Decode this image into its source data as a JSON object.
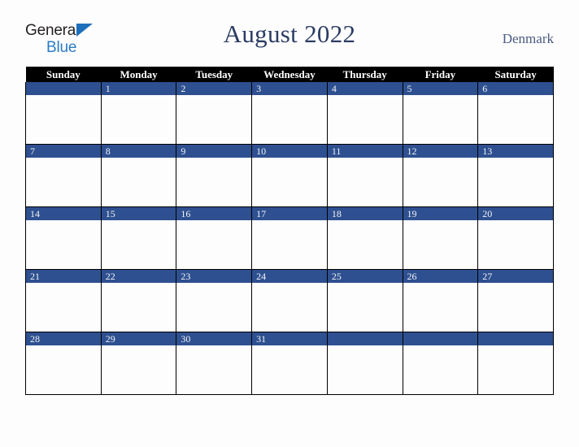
{
  "branding": {
    "logo_text_top": "General",
    "logo_text_bottom": "Blue",
    "logo_triangle_icon": "triangle-icon",
    "logo_top_color": "#231f20",
    "logo_bottom_color": "#2b7cc6",
    "logo_triangle_color": "#1d6fbc"
  },
  "header": {
    "title": "August 2022",
    "region": "Denmark",
    "title_color": "#2b3c63",
    "region_color": "#4a5b82"
  },
  "calendar": {
    "month": "August",
    "year": "2022",
    "header_background": "#000000",
    "header_text_color": "#ffffff",
    "daynum_background": "#2e5090",
    "daynum_text_color": "#f2f4f8",
    "cell_background": "#fdfdfd",
    "border_color": "#000000",
    "weekdays": [
      "Sunday",
      "Monday",
      "Tuesday",
      "Wednesday",
      "Thursday",
      "Friday",
      "Saturday"
    ],
    "weeks": [
      [
        "",
        "1",
        "2",
        "3",
        "4",
        "5",
        "6"
      ],
      [
        "7",
        "8",
        "9",
        "10",
        "11",
        "12",
        "13"
      ],
      [
        "14",
        "15",
        "16",
        "17",
        "18",
        "19",
        "20"
      ],
      [
        "21",
        "22",
        "23",
        "24",
        "25",
        "26",
        "27"
      ],
      [
        "28",
        "29",
        "30",
        "31",
        "",
        "",
        ""
      ]
    ]
  }
}
